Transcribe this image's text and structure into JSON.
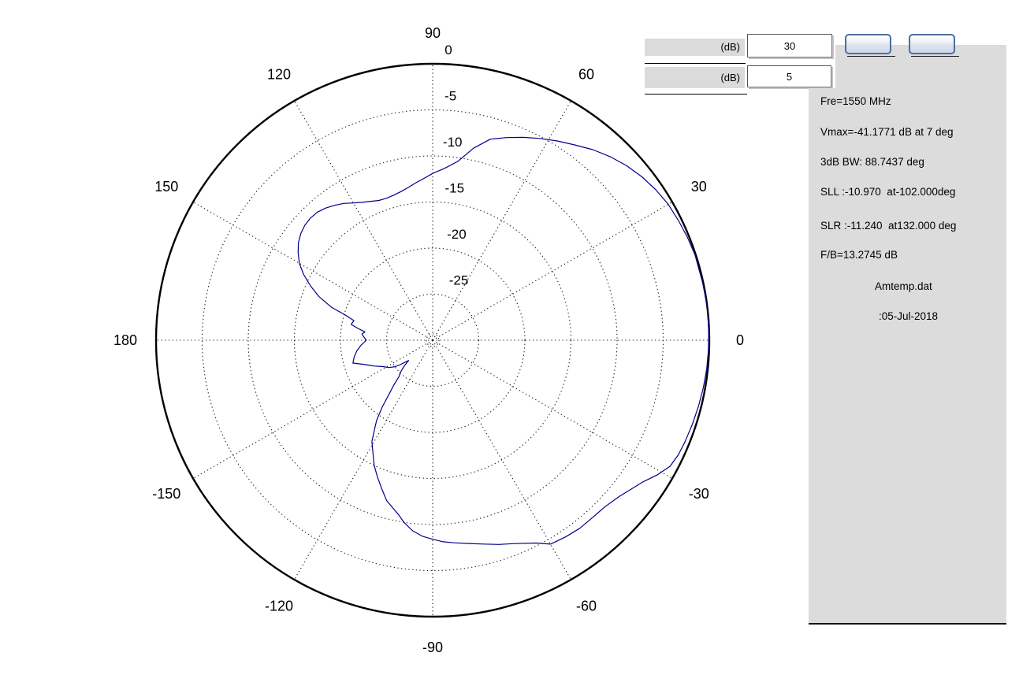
{
  "controls": {
    "db_scale": {
      "label": "(dB)",
      "value": "30"
    },
    "db_step": {
      "label": "(dB)",
      "value": "5"
    },
    "button1_label": "",
    "button2_label": ""
  },
  "info_panel": {
    "lines": [
      "Fre=1550 MHz",
      "Vmax=-41.1771 dB at 7 deg",
      "3dB BW: 88.7437 deg",
      "SLL :-10.970  at-102.000deg",
      "SLR :-11.240  at132.000 deg",
      "F/B=13.2745 dB"
    ],
    "file_name": "Amtemp.dat",
    "date": ":05-Jul-2018"
  },
  "chart_data": {
    "type": "line",
    "subtype": "polar-radiation-pattern",
    "units": "dB",
    "r_range_db": [
      -30,
      0
    ],
    "ring_step_db": 5,
    "radial_ticks": [
      {
        "label": "0",
        "db": 0
      },
      {
        "label": "-5",
        "db": -5
      },
      {
        "label": "-10",
        "db": -10
      },
      {
        "label": "-15",
        "db": -15
      },
      {
        "label": "-20",
        "db": -20
      },
      {
        "label": "-25",
        "db": -25
      }
    ],
    "angle_ticks": [
      {
        "label": "0",
        "angle": 0
      },
      {
        "label": "30",
        "angle": 30
      },
      {
        "label": "60",
        "angle": 60
      },
      {
        "label": "90",
        "angle": 90
      },
      {
        "label": "120",
        "angle": 120
      },
      {
        "label": "150",
        "angle": 150
      },
      {
        "label": "180",
        "angle": 180
      },
      {
        "label": "-150",
        "angle": -150
      },
      {
        "label": "-120",
        "angle": -120
      },
      {
        "label": "-90",
        "angle": -90
      },
      {
        "label": "-60",
        "angle": -60
      },
      {
        "label": "-30",
        "angle": -30
      }
    ],
    "grid_color": "#1b1b1b",
    "series": [
      {
        "name": "radiation-pattern",
        "color": "#00008B",
        "points": [
          [
            -180,
            -22.8
          ],
          [
            -176,
            -22.2
          ],
          [
            -172,
            -21.7
          ],
          [
            -168,
            -21.3
          ],
          [
            -164,
            -21.0
          ],
          [
            -161,
            -22.0
          ],
          [
            -158,
            -22.7
          ],
          [
            -156,
            -23.1
          ],
          [
            -152,
            -23.9
          ],
          [
            -148,
            -24.4
          ],
          [
            -145,
            -25.0
          ],
          [
            -143,
            -25.6
          ],
          [
            -141,
            -26.3
          ],
          [
            -140,
            -26.6
          ],
          [
            -138,
            -25.9
          ],
          [
            -135,
            -25.0
          ],
          [
            -133,
            -24.7
          ],
          [
            -131,
            -23.6
          ],
          [
            -129,
            -22.5
          ],
          [
            -127,
            -20.9
          ],
          [
            -125,
            -19.4
          ],
          [
            -123,
            -18.4
          ],
          [
            -121,
            -17.2
          ],
          [
            -118,
            -16.2
          ],
          [
            -115,
            -15.0
          ],
          [
            -112,
            -14.0
          ],
          [
            -109,
            -13.0
          ],
          [
            -106,
            -11.9
          ],
          [
            -103,
            -11.2
          ],
          [
            -101,
            -10.7
          ],
          [
            -99,
            -10.0
          ],
          [
            -96,
            -9.2
          ],
          [
            -93,
            -8.7
          ],
          [
            -90,
            -8.4
          ],
          [
            -87,
            -8.1
          ],
          [
            -84,
            -7.9
          ],
          [
            -80,
            -7.6
          ],
          [
            -76,
            -7.2
          ],
          [
            -72,
            -6.7
          ],
          [
            -68,
            -6.2
          ],
          [
            -63,
            -5.3
          ],
          [
            -60,
            -4.45
          ],
          [
            -56,
            -4.25
          ],
          [
            -52,
            -4.1
          ],
          [
            -48,
            -4.1
          ],
          [
            -44,
            -4.0
          ],
          [
            -40,
            -3.6
          ],
          [
            -37,
            -3.1
          ],
          [
            -34,
            -2.5
          ],
          [
            -31,
            -1.6
          ],
          [
            -28,
            -0.85
          ],
          [
            -25,
            -0.6
          ],
          [
            -22,
            -0.5
          ],
          [
            -18,
            -0.4
          ],
          [
            -14,
            -0.3
          ],
          [
            -10,
            -0.2
          ],
          [
            -6,
            -0.12
          ],
          [
            -2,
            -0.08
          ],
          [
            2,
            -0.04
          ],
          [
            7,
            0
          ],
          [
            12,
            -0.06
          ],
          [
            18,
            -0.08
          ],
          [
            22,
            -0.2
          ],
          [
            26,
            -0.35
          ],
          [
            30,
            -0.5
          ],
          [
            34,
            -0.8
          ],
          [
            38,
            -1.2
          ],
          [
            42,
            -1.7
          ],
          [
            46,
            -2.3
          ],
          [
            50,
            -3.0
          ],
          [
            54,
            -3.8
          ],
          [
            58,
            -4.5
          ],
          [
            62,
            -5.2
          ],
          [
            66,
            -5.9
          ],
          [
            70,
            -6.6
          ],
          [
            74,
            -7.3
          ],
          [
            78,
            -8.7
          ],
          [
            82,
            -10.4
          ],
          [
            86,
            -11.3
          ],
          [
            90,
            -11.9
          ],
          [
            93,
            -12.4
          ],
          [
            96,
            -12.8
          ],
          [
            99,
            -13.2
          ],
          [
            102,
            -13.5
          ],
          [
            105,
            -13.7
          ],
          [
            108,
            -13.8
          ],
          [
            111,
            -13.75
          ],
          [
            114,
            -13.5
          ],
          [
            117,
            -13.2
          ],
          [
            120,
            -12.8
          ],
          [
            123,
            -12.3
          ],
          [
            126,
            -11.9
          ],
          [
            129,
            -11.55
          ],
          [
            132,
            -11.3
          ],
          [
            135,
            -11.25
          ],
          [
            138,
            -11.35
          ],
          [
            141,
            -11.6
          ],
          [
            144,
            -12.0
          ],
          [
            147,
            -12.6
          ],
          [
            150,
            -13.3
          ],
          [
            153,
            -14.3
          ],
          [
            156,
            -15.5
          ],
          [
            159,
            -16.8
          ],
          [
            162,
            -18.5
          ],
          [
            164,
            -20.2
          ],
          [
            166,
            -21.2
          ],
          [
            169,
            -21.0
          ],
          [
            171,
            -21.8
          ],
          [
            173,
            -22.6
          ],
          [
            175,
            -22.3
          ],
          [
            177,
            -22.5
          ],
          [
            180,
            -22.8
          ]
        ],
        "annotations": {
          "max_db_at_deg": 7,
          "sll_db": -10.97,
          "sll_deg": -102,
          "slr_db": -11.24,
          "slr_deg": 132
        }
      }
    ]
  }
}
